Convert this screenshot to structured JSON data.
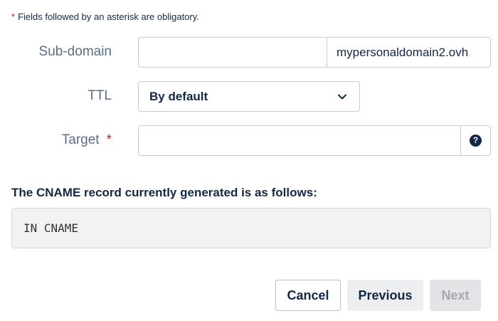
{
  "form": {
    "required_note": "Fields followed by an asterisk are obligatory.",
    "required_mark": "*",
    "subdomain": {
      "label": "Sub-domain",
      "value": "",
      "suffix": "mypersonaldomain2.ovh"
    },
    "ttl": {
      "label": "TTL",
      "selected": "By default"
    },
    "target": {
      "label": "Target",
      "value": "",
      "help_glyph": "?"
    }
  },
  "record": {
    "title": "The CNAME record currently generated is as follows:",
    "value": "IN CNAME"
  },
  "actions": {
    "cancel": "Cancel",
    "previous": "Previous",
    "next": "Next"
  },
  "colors": {
    "text": "#122844",
    "label": "#5b6d87",
    "required": "#c71f2b",
    "border": "#c8cdd4",
    "disabled_text": "#a4a9b0"
  }
}
